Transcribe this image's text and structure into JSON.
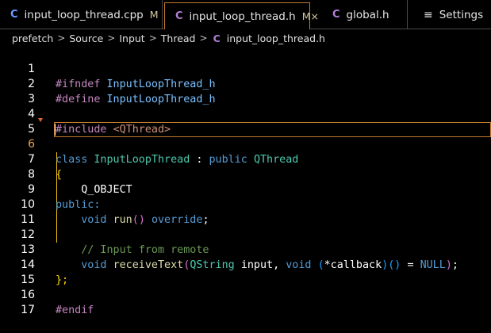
{
  "tabs": [
    {
      "icon": "C",
      "label": "input_loop_thread.cpp",
      "modified": "M"
    },
    {
      "icon": "C",
      "label": "input_loop_thread.h",
      "modified": "M",
      "close": "×"
    },
    {
      "icon": "C",
      "label": "global.h"
    },
    {
      "icon": "≡",
      "label": "Settings"
    }
  ],
  "breadcrumb": {
    "segments": [
      "prefetch",
      "Source",
      "Input",
      "Thread"
    ],
    "file_icon": "C",
    "file": "input_loop_thread.h",
    "separator": ">"
  },
  "editor": {
    "line_numbers": [
      "1",
      "2",
      "3",
      "4",
      "5",
      "6",
      "7",
      "8",
      "9",
      "10",
      "11",
      "12",
      "13",
      "14",
      "15",
      "16",
      "17"
    ],
    "current_line": "6",
    "lines": {
      "l1": {
        "directive": "#ifndef",
        "name": "InputLoopThread_h"
      },
      "l2": {
        "directive": "#define",
        "name": "InputLoopThread_h"
      },
      "l4": {
        "directive": "#include",
        "header": "<QThread>"
      },
      "l6": {
        "kw_class": "class",
        "class_name": "InputLoopThread",
        "colon": ":",
        "kw_public": "public",
        "base": "QThread"
      },
      "l7": {
        "brace": "{"
      },
      "l8": {
        "macro": "Q_OBJECT"
      },
      "l9": {
        "access": "public:"
      },
      "l10": {
        "kw_void": "void",
        "fn": "run",
        "paren_open": "(",
        "paren_close": ")",
        "kw_override": "override",
        "semi": ";"
      },
      "l12": {
        "comment": "// Input from remote"
      },
      "l13": {
        "kw_void": "void",
        "fn": "receiveText",
        "paren_open": "(",
        "type1": "QString",
        "param1": "input",
        "comma": ",",
        "kw_void2": "void",
        "ptr_open": "(",
        "ptr": "*callback",
        "ptr_close": ")",
        "args": "()",
        "eq": "=",
        "null": "NULL",
        "paren_close": ")",
        "semi": ";"
      },
      "l14": {
        "brace": "};"
      },
      "l16": {
        "directive": "#endif"
      }
    }
  },
  "colors": {
    "background": "#000000",
    "active_tab_border": "#c47a2c",
    "preprocessor": "#c586c0",
    "keyword": "#569cd6",
    "type": "#4ec9b0",
    "include_string": "#ce9178",
    "function": "#dcdcaa",
    "comment": "#6a9955",
    "bracket_gold": "#ffd700"
  }
}
